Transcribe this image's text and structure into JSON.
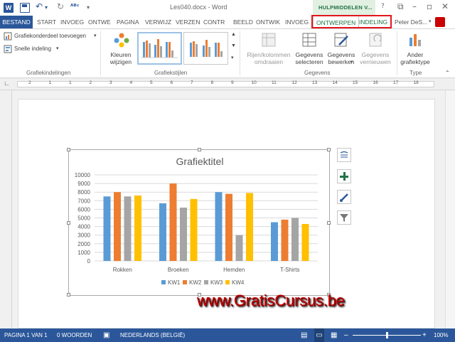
{
  "titlebar": {
    "doc_title": "Les040.docx - Word",
    "contextual_group": "HULPMIDDELEN V...",
    "help": "?",
    "app_icon_letter": "W"
  },
  "tabs": [
    {
      "label": "BESTAND"
    },
    {
      "label": "START"
    },
    {
      "label": "INVOEG"
    },
    {
      "label": "ONTWE"
    },
    {
      "label": "PAGINA"
    },
    {
      "label": "VERWIJZ"
    },
    {
      "label": "VERZEN"
    },
    {
      "label": "CONTR"
    },
    {
      "label": "BEELD"
    },
    {
      "label": "ONTWIK"
    },
    {
      "label": "INVOEG"
    },
    {
      "label": "ONTWERPEN"
    },
    {
      "label": "INDELING"
    }
  ],
  "user": {
    "name": "Peter DeS..."
  },
  "ribbon": {
    "add_element": "Grafiekonderdeel toevoegen",
    "quick_layout": "Snelle indeling",
    "group_layouts": "Grafiekindelingen",
    "change_colors": "Kleuren wijzigen",
    "group_styles": "Grafiekstijlen",
    "switch_rowcol": "Rijen/kolommen omdraaien",
    "select_data": "Gegevens selecteren",
    "edit_data": "Gegevens bewerken",
    "refresh_data": "Gegevens vernieuwen",
    "group_data": "Gegevens",
    "change_type": "Ander grafiektype",
    "group_type": "Type"
  },
  "ruler": {
    "ticks": [
      "2",
      "1",
      "1",
      "2",
      "3",
      "4",
      "5",
      "6",
      "7",
      "8",
      "9",
      "10",
      "11",
      "12",
      "13",
      "14",
      "15",
      "16",
      "17",
      "18"
    ]
  },
  "chart_data": {
    "type": "bar",
    "title": "Grafiektitel",
    "categories": [
      "Rokken",
      "Broeken",
      "Hemden",
      "T-Shirts"
    ],
    "series": [
      {
        "name": "KW1",
        "color": "#5b9bd5",
        "values": [
          7500,
          6700,
          8000,
          4500
        ]
      },
      {
        "name": "KW2",
        "color": "#ed7d31",
        "values": [
          8000,
          9000,
          7800,
          4800
        ]
      },
      {
        "name": "KW3",
        "color": "#a5a5a5",
        "values": [
          7500,
          6200,
          3000,
          5000
        ]
      },
      {
        "name": "KW4",
        "color": "#ffc000",
        "values": [
          7600,
          7200,
          7900,
          4300
        ]
      }
    ],
    "ylim": [
      0,
      10000
    ],
    "yticks": [
      0,
      1000,
      2000,
      3000,
      4000,
      5000,
      6000,
      7000,
      8000,
      9000,
      10000
    ],
    "grid": true,
    "legend": "bottom"
  },
  "watermark": "www.GratisCursus.be",
  "status": {
    "page": "PAGINA 1 VAN 1",
    "words": "0 WOORDEN",
    "language": "NEDERLANDS (BELGIË)",
    "zoom": "100%"
  },
  "colors": {
    "accent": "#2b579a",
    "contextual": "#217346",
    "highlight": "#e2151c"
  }
}
